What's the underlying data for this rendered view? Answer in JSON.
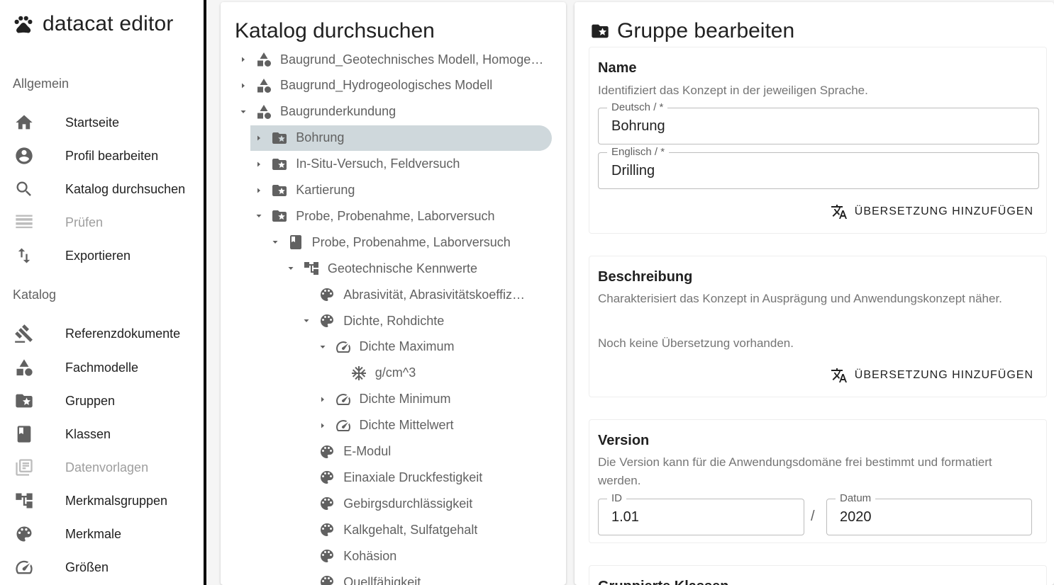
{
  "app": {
    "title": "datacat editor"
  },
  "sidebar": {
    "section_general": "Allgemein",
    "section_catalog": "Katalog",
    "general_items": [
      {
        "label": "Startseite",
        "icon": "home-icon",
        "disabled": false
      },
      {
        "label": "Profil bearbeiten",
        "icon": "account-circle-icon",
        "disabled": false
      },
      {
        "label": "Katalog durchsuchen",
        "icon": "search-icon",
        "disabled": false
      },
      {
        "label": "Prüfen",
        "icon": "list-check-icon",
        "disabled": true
      },
      {
        "label": "Exportieren",
        "icon": "import-export-icon",
        "disabled": false
      }
    ],
    "catalog_items": [
      {
        "label": "Referenzdokumente",
        "icon": "gavel-icon",
        "disabled": false
      },
      {
        "label": "Fachmodelle",
        "icon": "shapes-icon",
        "disabled": false
      },
      {
        "label": "Gruppen",
        "icon": "folder-star-icon",
        "disabled": false
      },
      {
        "label": "Klassen",
        "icon": "book-icon",
        "disabled": false
      },
      {
        "label": "Datenvorlagen",
        "icon": "library-icon",
        "disabled": true
      },
      {
        "label": "Merkmalsgruppen",
        "icon": "account-tree-icon",
        "disabled": false
      },
      {
        "label": "Merkmale",
        "icon": "palette-icon",
        "disabled": false
      },
      {
        "label": "Größen",
        "icon": "speed-icon",
        "disabled": false
      }
    ]
  },
  "catalog": {
    "title": "Katalog durchsuchen",
    "tree": [
      {
        "label": "Baugrund_Geotechnisches Modell, Homoge…",
        "level": 0,
        "caret": "right",
        "icon": "shapes-icon",
        "selected": false
      },
      {
        "label": "Baugrund_Hydrogeologisches Modell",
        "level": 0,
        "caret": "right",
        "icon": "shapes-icon",
        "selected": false
      },
      {
        "label": "Baugrunderkundung",
        "level": 0,
        "caret": "down",
        "icon": "shapes-icon",
        "selected": false
      },
      {
        "label": "Bohrung",
        "level": 1,
        "caret": "right",
        "icon": "folder-star-icon",
        "selected": true
      },
      {
        "label": "In-Situ-Versuch, Feldversuch",
        "level": 1,
        "caret": "right",
        "icon": "folder-star-icon",
        "selected": false
      },
      {
        "label": "Kartierung",
        "level": 1,
        "caret": "right",
        "icon": "folder-star-icon",
        "selected": false
      },
      {
        "label": "Probe, Probenahme, Laborversuch",
        "level": 1,
        "caret": "down",
        "icon": "folder-star-icon",
        "selected": false
      },
      {
        "label": "Probe, Probenahme, Laborversuch",
        "level": 2,
        "caret": "down",
        "icon": "book-icon",
        "selected": false
      },
      {
        "label": "Geotechnische Kennwerte",
        "level": 3,
        "caret": "down",
        "icon": "account-tree-icon",
        "selected": false
      },
      {
        "label": "Abrasivität, Abrasivitätskoeffiz…",
        "level": 4,
        "caret": "none",
        "icon": "palette-icon",
        "selected": false
      },
      {
        "label": "Dichte, Rohdichte",
        "level": 4,
        "caret": "down",
        "icon": "palette-icon",
        "selected": false
      },
      {
        "label": "Dichte Maximum",
        "level": 5,
        "caret": "down",
        "icon": "speed-icon",
        "selected": false
      },
      {
        "label": "g/cm^3",
        "level": 6,
        "caret": "none",
        "icon": "unit-icon",
        "selected": false
      },
      {
        "label": "Dichte Minimum",
        "level": 5,
        "caret": "right",
        "icon": "speed-icon",
        "selected": false
      },
      {
        "label": "Dichte Mittelwert",
        "level": 5,
        "caret": "right",
        "icon": "speed-icon",
        "selected": false
      },
      {
        "label": "E-Modul",
        "level": 4,
        "caret": "none",
        "icon": "palette-icon",
        "selected": false
      },
      {
        "label": "Einaxiale Druckfestigkeit",
        "level": 4,
        "caret": "none",
        "icon": "palette-icon",
        "selected": false
      },
      {
        "label": "Gebirgsdurchlässigkeit",
        "level": 4,
        "caret": "none",
        "icon": "palette-icon",
        "selected": false
      },
      {
        "label": "Kalkgehalt, Sulfatgehalt",
        "level": 4,
        "caret": "none",
        "icon": "palette-icon",
        "selected": false
      },
      {
        "label": "Kohäsion",
        "level": 4,
        "caret": "none",
        "icon": "palette-icon",
        "selected": false
      },
      {
        "label": "Quellfähigkeit",
        "level": 4,
        "caret": "none",
        "icon": "palette-icon",
        "selected": false
      }
    ]
  },
  "editor": {
    "title": "Gruppe bearbeiten",
    "name_card": {
      "heading": "Name",
      "description": "Identifiziert das Konzept in der jeweiligen Sprache.",
      "field_de_label": "Deutsch /  *",
      "field_de_value": "Bohrung",
      "field_en_label": "Englisch /  *",
      "field_en_value": "Drilling",
      "add_translation": "ÜBERSETZUNG HINZUFÜGEN"
    },
    "description_card": {
      "heading": "Beschreibung",
      "description": "Charakterisiert das Konzept in Ausprägung und Anwendungskonzept näher.",
      "empty_note": "Noch keine Übersetzung vorhanden.",
      "add_translation": "ÜBERSETZUNG HINZUFÜGEN"
    },
    "version_card": {
      "heading": "Version",
      "description": "Die Version kann für die Anwendungsdomäne frei bestimmt und formatiert werden.",
      "id_label": "ID",
      "id_value": "1.01",
      "separator": "/",
      "date_label": "Datum",
      "date_value": "2020"
    },
    "next_card_heading": "Gruppierte Klassen"
  },
  "colors": {
    "selected_bg": "#cfd8dc",
    "icon_gray": "#616161",
    "text_dark": "#212121",
    "text_muted": "#757575"
  }
}
